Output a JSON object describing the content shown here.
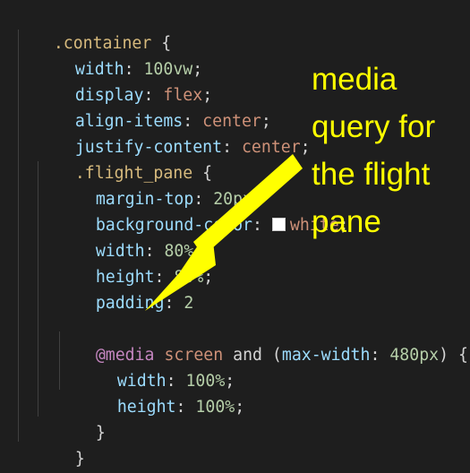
{
  "code": {
    "line1": {
      "selector": ".container",
      "brace": " {"
    },
    "line2": {
      "prop": "width",
      "colon": ": ",
      "number": "100vw",
      "semi": ";"
    },
    "line3": {
      "prop": "display",
      "colon": ": ",
      "value": "flex",
      "semi": ";"
    },
    "line4": {
      "prop": "align-items",
      "colon": ": ",
      "value": "center",
      "semi": ";"
    },
    "line5": {
      "prop": "justify-content",
      "colon": ": ",
      "value": "center",
      "semi": ";"
    },
    "line6": {
      "selector": ".flight_pane",
      "brace": " {"
    },
    "line7": {
      "prop": "margin-top",
      "colon": ": ",
      "number": "20px",
      "semi": ";"
    },
    "line8": {
      "prop": "background-color",
      "colon": ": ",
      "value": "white",
      "semi": ";"
    },
    "line9": {
      "prop": "width",
      "colon": ": ",
      "number": "80%",
      "semi": ";"
    },
    "line10": {
      "prop": "height",
      "colon": ": ",
      "number": "80%",
      "semi": ";"
    },
    "line11": {
      "prop": "padding",
      "colon": ": ",
      "number": "2",
      "semi": ""
    },
    "line13": {
      "at": "@media",
      "space1": " ",
      "screen": "screen",
      "and": " and (",
      "feature": "max-width",
      "colon": ": ",
      "number": "480px",
      "close": ") {"
    },
    "line14": {
      "prop": "width",
      "colon": ": ",
      "number": "100%",
      "semi": ";"
    },
    "line15": {
      "prop": "height",
      "colon": ": ",
      "number": "100%",
      "semi": ";"
    },
    "line16": {
      "brace": "}"
    },
    "line17": {
      "brace": "}"
    },
    "line18": {
      "brace": "}"
    }
  },
  "annotation": {
    "line1": "media",
    "line2": "query for",
    "line3": "the flight",
    "line4": "pane"
  },
  "colors": {
    "background": "#1e1e1e",
    "selector": "#d7ba7d",
    "property": "#9cdcfe",
    "value": "#ce9178",
    "number": "#b5cea8",
    "at_rule": "#c586c0",
    "annotation": "#ffff00",
    "swatch": "#ffffff"
  }
}
